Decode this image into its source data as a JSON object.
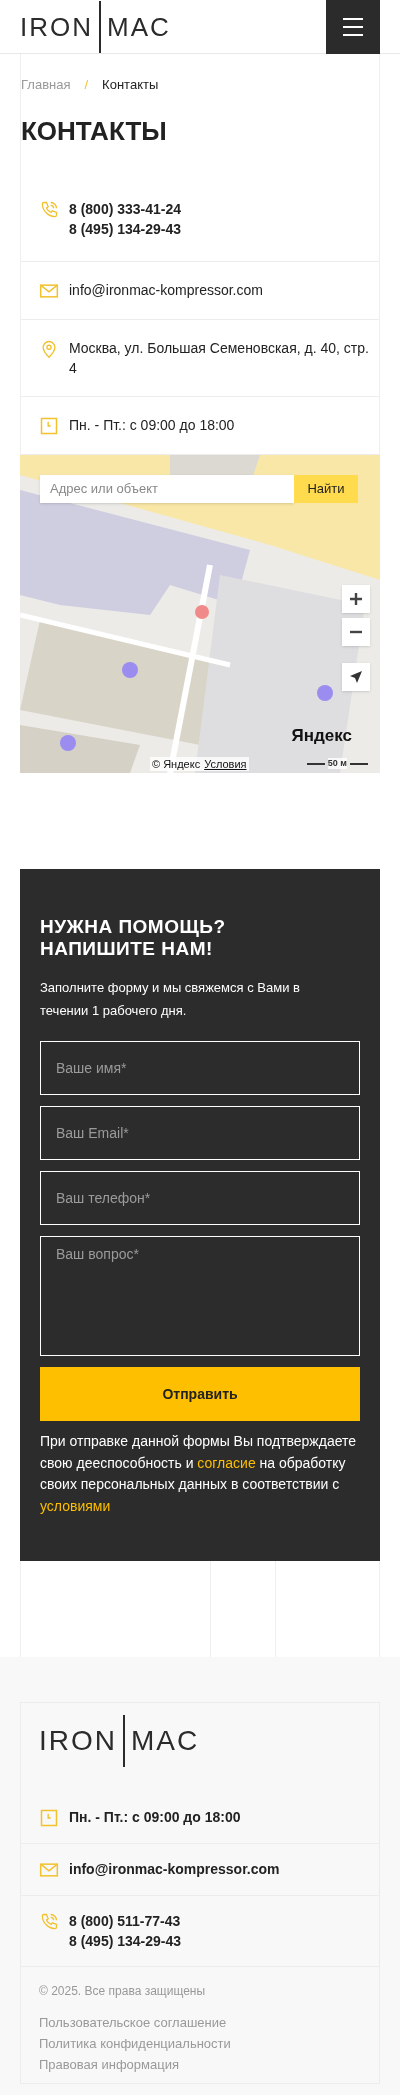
{
  "header": {
    "logo": {
      "left": "IRON",
      "right": "MAC"
    }
  },
  "breadcrumbs": [
    {
      "label": "Главная",
      "current": false
    },
    {
      "label": "Контакты",
      "current": true
    }
  ],
  "breadcrumb_separator": "/",
  "title": "КОНТАКТЫ",
  "contacts": [
    {
      "kind": "phone",
      "lines": [
        "8 (800) 333-41-24",
        "8 (495) 134-29-43"
      ]
    },
    {
      "kind": "email",
      "lines": [
        "info@ironmac-kompressor.com"
      ]
    },
    {
      "kind": "address",
      "lines": [
        "Москва, ул. Большая Семеновская, д. 40, стр. 4"
      ]
    },
    {
      "kind": "hours",
      "lines": [
        "Пн. - Пт.: с 09:00 до 18:00"
      ]
    }
  ],
  "map": {
    "search_placeholder": "Адрес или объект",
    "search_button": "Найти",
    "brand": "Яндекс",
    "copyright": "© Яндекс",
    "terms_link": "Условия",
    "scale": "50 м"
  },
  "form": {
    "title": "НУЖНА ПОМОЩЬ? НАПИШИТЕ НАМ!",
    "intro": "Заполните форму и мы свяжемся с Вами в течении 1 рабочего дня.",
    "fields": [
      {
        "kind": "input",
        "placeholder": "Ваше имя*"
      },
      {
        "kind": "input",
        "placeholder": "Ваш Email*"
      },
      {
        "kind": "input",
        "placeholder": "Ваш телефон*"
      },
      {
        "kind": "textarea",
        "placeholder": "Ваш вопрос*"
      }
    ],
    "submit": "Отправить",
    "consent": {
      "text_1": "При отправке данной формы Вы подтверждаете свою дееспособность и ",
      "link_1": "согласие",
      "text_2": " на обработку своих персональных данных в соответствии с ",
      "link_2": "условиями"
    }
  },
  "footer": {
    "logo": {
      "left": "IRON",
      "right": "MAC"
    },
    "contacts": [
      {
        "kind": "hours",
        "lines": [
          "Пн. - Пт.: с 09:00 до 18:00"
        ]
      },
      {
        "kind": "email",
        "lines": [
          "info@ironmac-kompressor.com"
        ]
      },
      {
        "kind": "phone",
        "lines": [
          "8 (800) 511-77-43",
          "8 (495) 134-29-43"
        ]
      }
    ],
    "copyright": "© 2025. Все права защищены",
    "links": [
      "Пользовательское соглашение",
      "Политика конфиденциальности",
      "Правовая информация"
    ]
  }
}
